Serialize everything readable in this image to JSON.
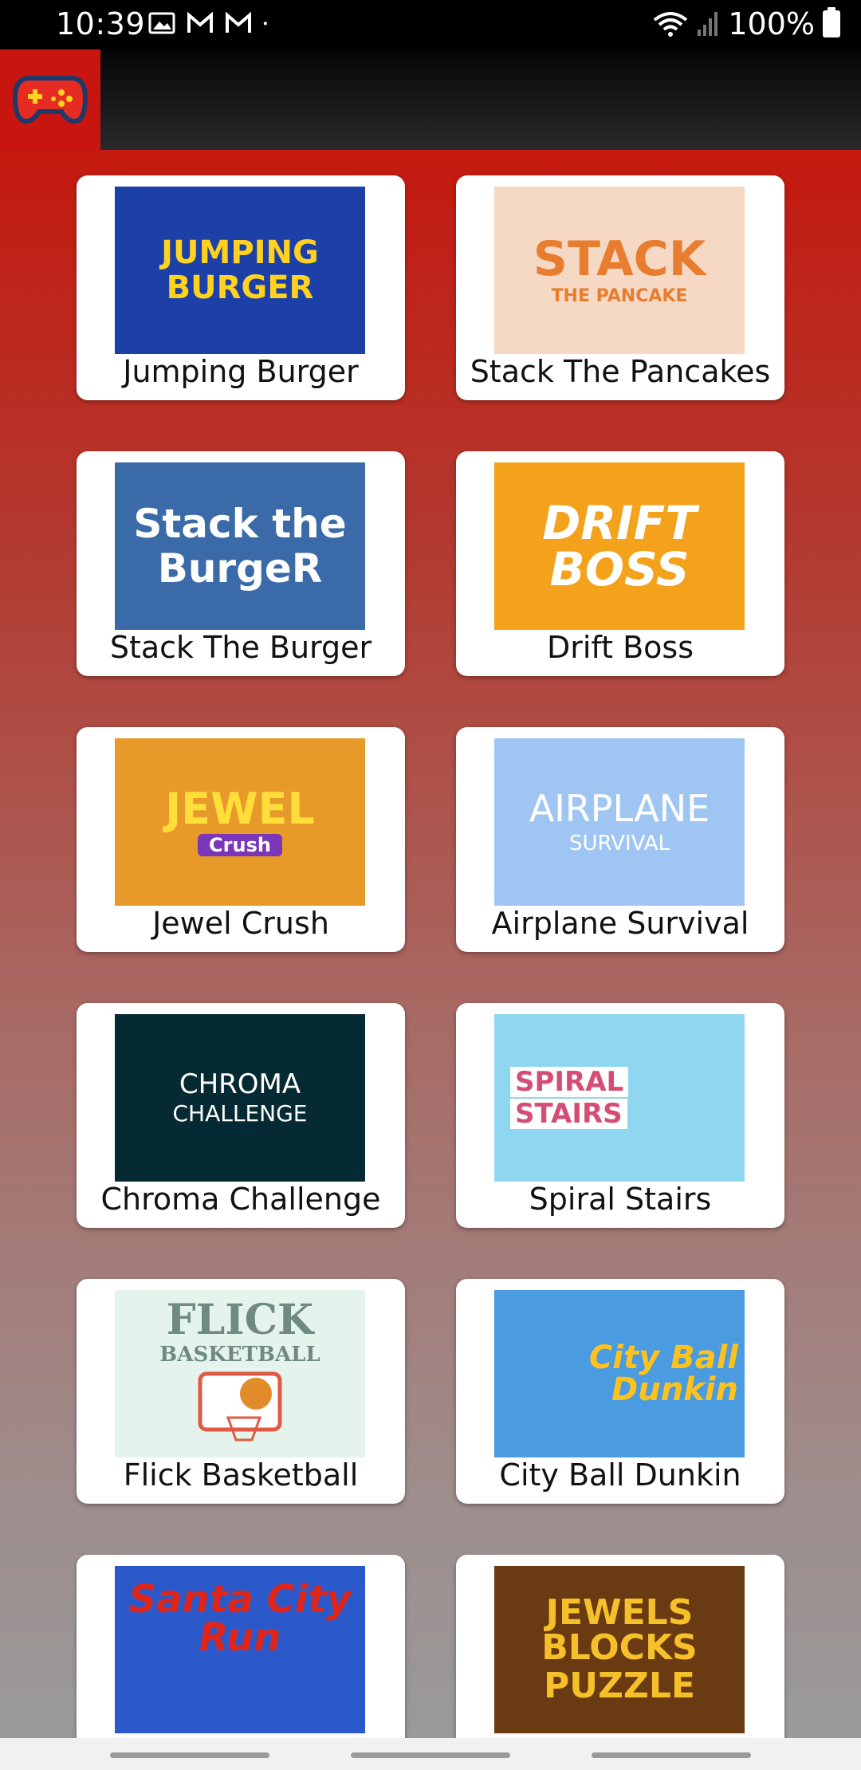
{
  "status_bar": {
    "time": "10:39",
    "battery": "100%",
    "icons": [
      "image-icon",
      "gmail-icon",
      "gmail-icon",
      "dot-icon",
      "wifi-icon",
      "signal-icon",
      "battery-icon"
    ]
  },
  "app_bar": {
    "logo_icon": "gamepad-icon",
    "logo_bg": "#c9150f"
  },
  "games": [
    {
      "title": "Jumping Burger",
      "art_line1": "JUMPING",
      "art_line2": "BURGER",
      "art_bg": "#1d3fa8",
      "art_fg": "#ffd21f"
    },
    {
      "title": "Stack The Pancakes",
      "art_line1": "STACK",
      "art_line2": "THE PANCAKE",
      "art_bg": "#f6d9c4",
      "art_fg": "#e87d2f"
    },
    {
      "title": "Stack The Burger",
      "art_line1": "Stack the",
      "art_line2": "BurgeR",
      "art_bg": "#3a6aa8",
      "art_fg": "#ffffff"
    },
    {
      "title": "Drift Boss",
      "art_line1": "DRIFT",
      "art_line2": "BOSS",
      "art_bg": "#f4a11b",
      "art_fg": "#ffffff"
    },
    {
      "title": "Jewel Crush",
      "art_line1": "JEWEL",
      "art_line2": "Crush",
      "art_bg": "#e79a2a",
      "art_fg": "#ffde3a"
    },
    {
      "title": "Airplane Survival",
      "art_line1": "AIRPLANE",
      "art_line2": "SURVIVAL",
      "art_bg": "#9fc6f3",
      "art_fg": "#ffffff"
    },
    {
      "title": "Chroma Challenge",
      "art_line1": "CHROMA",
      "art_line2": "CHALLENGE",
      "art_bg": "#062a33",
      "art_fg": "#ffffff"
    },
    {
      "title": "Spiral Stairs",
      "art_line1": "SPIRAL",
      "art_line2": "STAIRS",
      "art_bg": "#8fd7f0",
      "art_fg": "#d64d74"
    },
    {
      "title": "Flick Basketball",
      "art_line1": "FLICK",
      "art_line2": "BASKETBALL",
      "art_bg": "#e4f3ec",
      "art_fg": "#6f8a82"
    },
    {
      "title": "City Ball Dunkin",
      "art_line1": "City Ball",
      "art_line2": "Dunkin",
      "art_bg": "#4a9be0",
      "art_fg": "#ffc21d"
    },
    {
      "title": "",
      "art_line1": "Santa City",
      "art_line2": "Run",
      "art_bg": "#2c59c9",
      "art_fg": "#e0261a"
    },
    {
      "title": "",
      "art_line1": "JEWELS BLOCKS",
      "art_line2": "PUZZLE",
      "art_bg": "#6a3a12",
      "art_fg": "#f6c02b"
    }
  ]
}
